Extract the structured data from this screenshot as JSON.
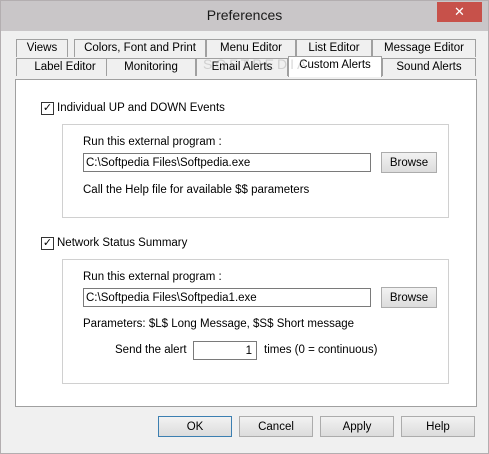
{
  "window": {
    "title": "Preferences",
    "close_symbol": "✕"
  },
  "watermark": "SOFTPEDIA",
  "tabs_row1": [
    "Views",
    "Colors, Font and Print",
    "Menu Editor",
    "List Editor",
    "Message Editor"
  ],
  "tabs_row2": [
    "Label Editor",
    "Monitoring",
    "Email Alerts",
    "Custom Alerts",
    "Sound Alerts"
  ],
  "active_tab": "Custom Alerts",
  "individual": {
    "checkbox_label": "Individual UP and DOWN Events",
    "checked": true,
    "run_label": "Run this external program :",
    "program_value": "C:\\Softpedia Files\\Softpedia.exe",
    "browse_label": "Browse",
    "help_text": "Call the Help file for available $$ parameters"
  },
  "network": {
    "checkbox_label": "Network Status Summary",
    "checked": true,
    "run_label": "Run this external program :",
    "program_value": "C:\\Softpedia Files\\Softpedia1.exe",
    "browse_label": "Browse",
    "params_text": "Parameters: $L$ Long Message, $S$ Short message",
    "send_label": "Send the alert",
    "send_value": "1",
    "times_label": "times (0 = continuous)"
  },
  "buttons": {
    "ok": "OK",
    "cancel": "Cancel",
    "apply": "Apply",
    "help": "Help"
  }
}
